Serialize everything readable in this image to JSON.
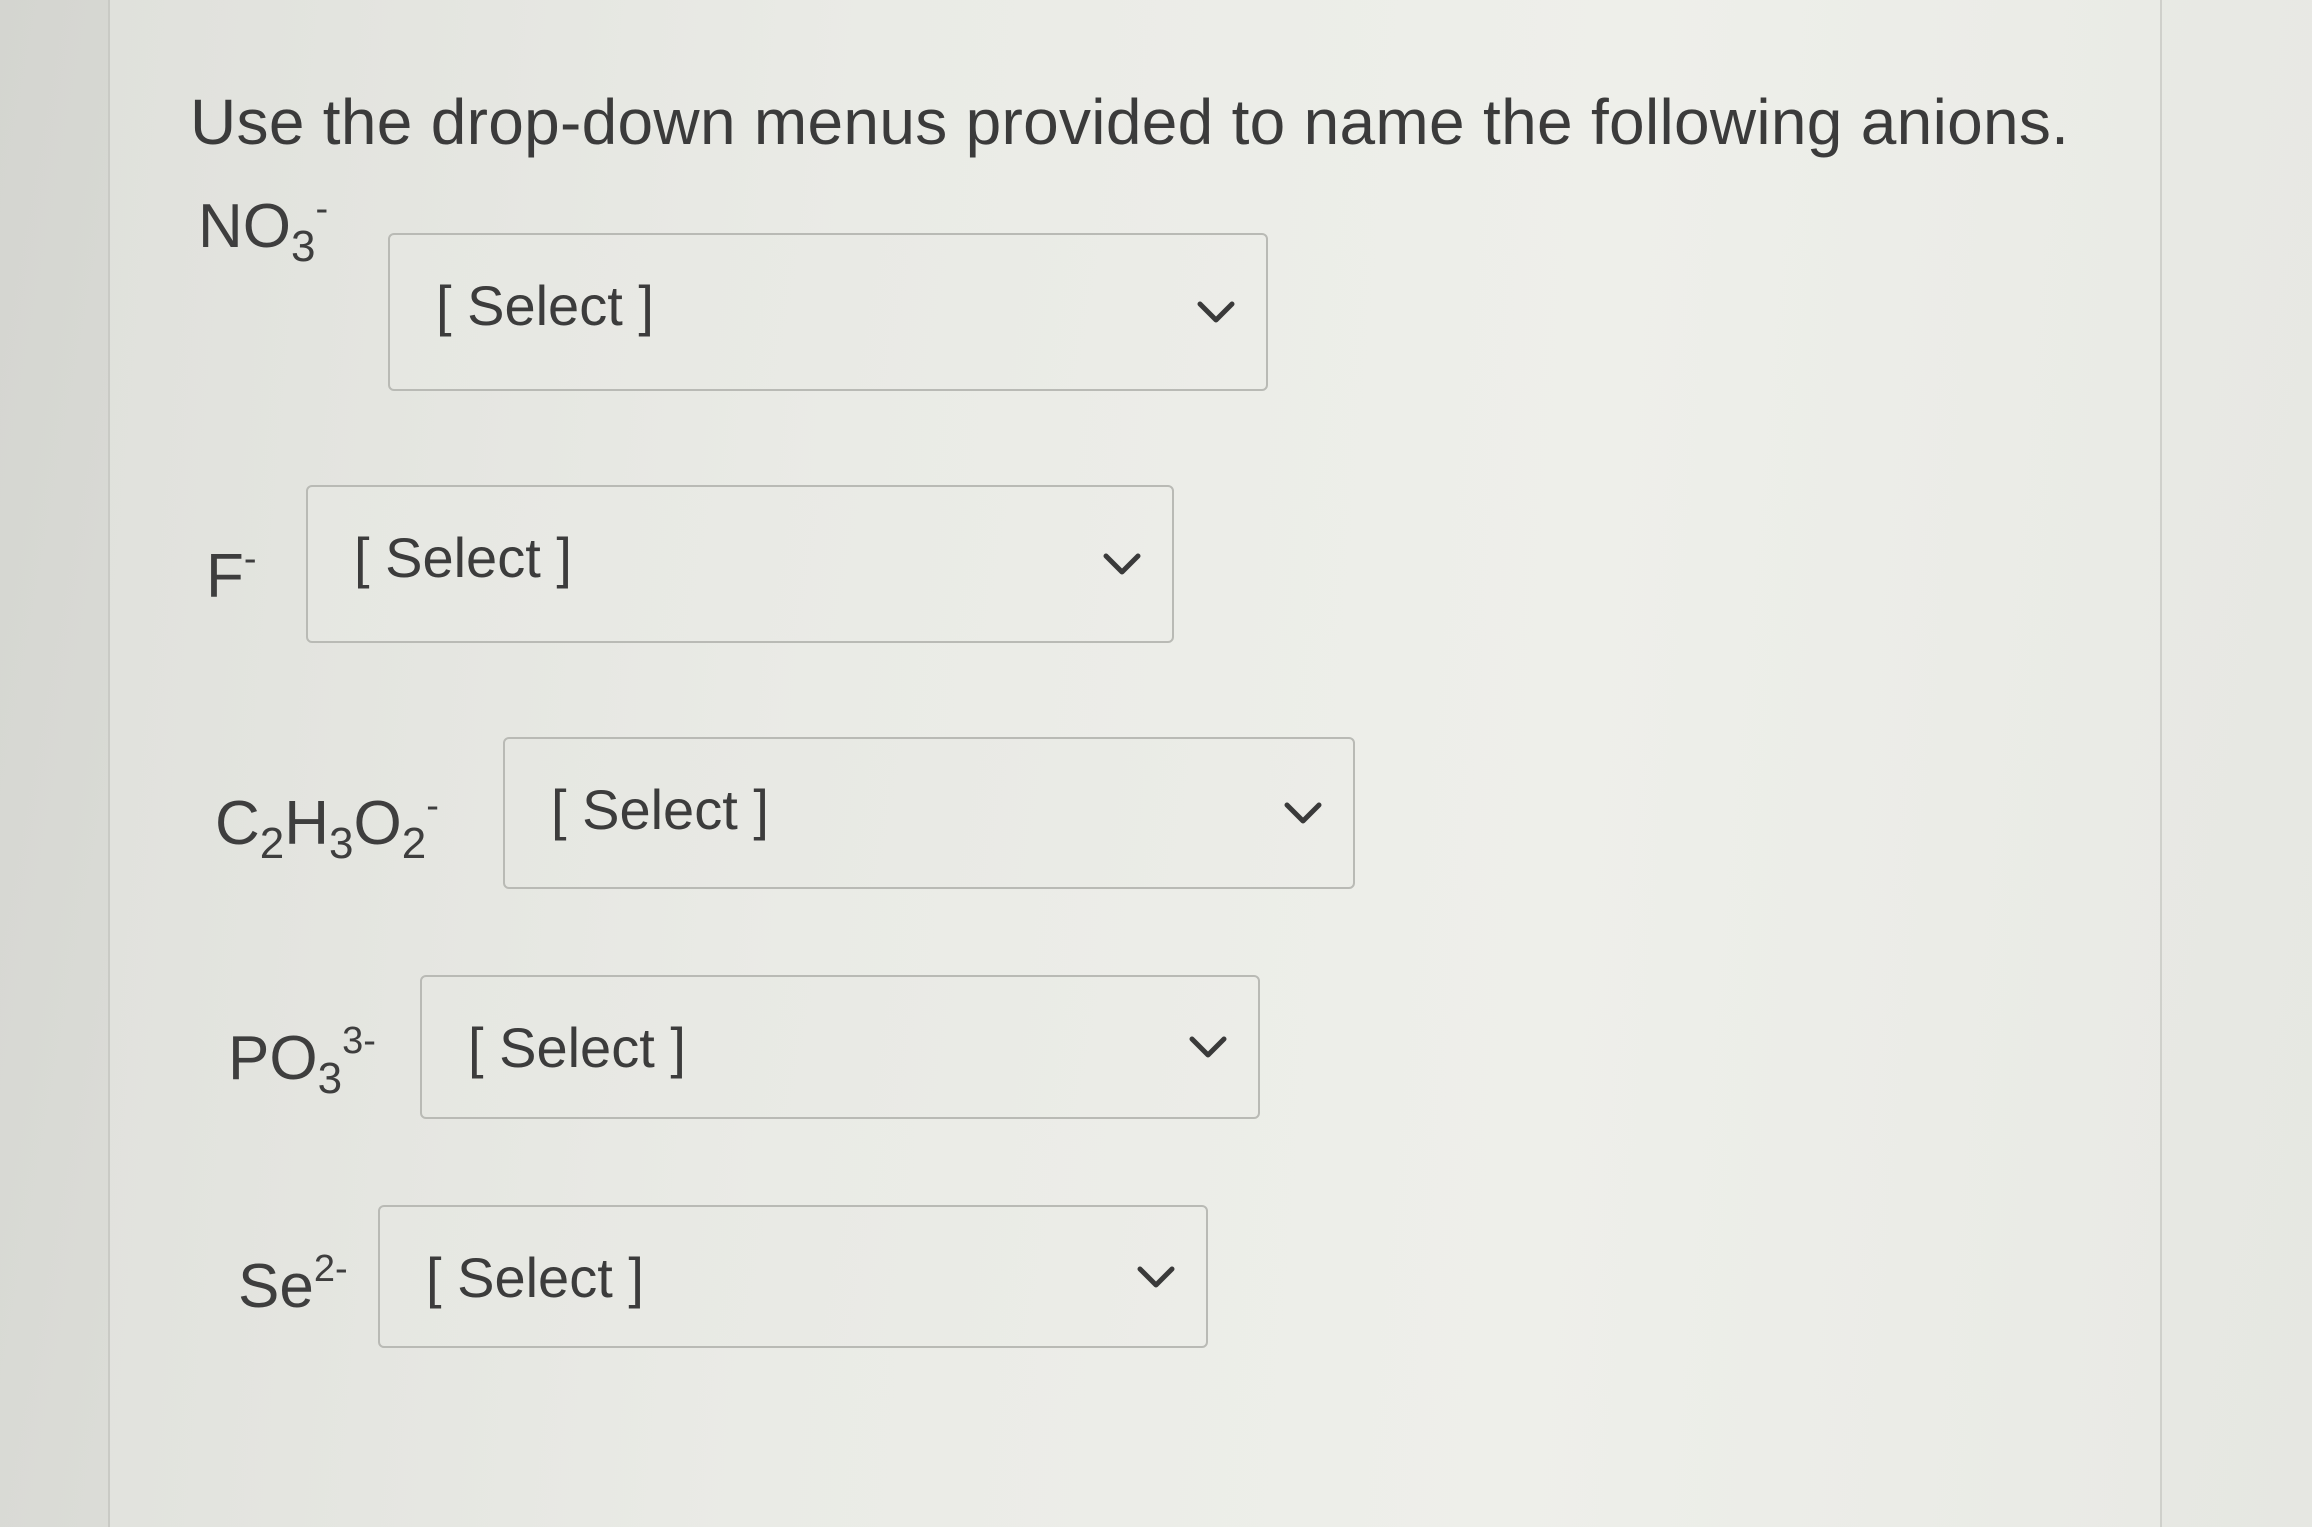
{
  "question": "Use the drop-down menus provided to name the following anions.",
  "rows": [
    {
      "base": "NO",
      "sub": "3",
      "sup": "-",
      "select_value": "[ Select ]"
    },
    {
      "base": "F",
      "sub": "",
      "sup": "-",
      "select_value": "[ Select ]"
    },
    {
      "base_parts": [
        "C",
        "2",
        "H",
        "3",
        "O",
        "2"
      ],
      "sup": "-",
      "select_value": "[ Select ]"
    },
    {
      "base": "PO",
      "sub": "3",
      "sup": "3-",
      "select_value": "[ Select ]"
    },
    {
      "base": "Se",
      "sub": "",
      "sup": "2-",
      "select_value": "[ Select ]"
    }
  ],
  "icons": {
    "dropdown": "chevron-down-icon"
  }
}
